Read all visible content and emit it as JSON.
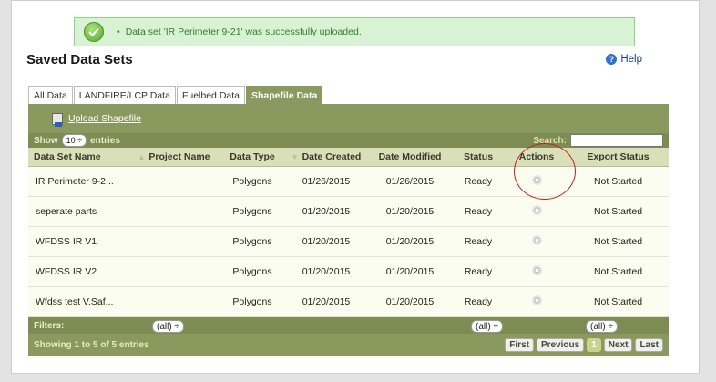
{
  "alert": {
    "message": "Data set 'IR Perimeter 9-21' was successfully uploaded.",
    "bullet": "•"
  },
  "page_title": "Saved Data Sets",
  "help_label": "Help",
  "tabs": [
    {
      "label": "All Data"
    },
    {
      "label": "LANDFIRE/LCP Data"
    },
    {
      "label": "Fuelbed Data"
    },
    {
      "label": "Shapefile Data"
    }
  ],
  "upload_label": "Upload Shapefile",
  "controls": {
    "show_label": "Show",
    "entries_value": "10 ÷",
    "entries_label": "entries",
    "search_label": "Search:"
  },
  "columns": [
    "Data Set Name",
    "Project Name",
    "Data Type",
    "Date Created",
    "Date Modified",
    "Status",
    "Actions",
    "Export Status"
  ],
  "rows": [
    {
      "name": "IR Perimeter 9-2...",
      "project": "",
      "type": "Polygons",
      "created": "01/26/2015",
      "modified": "01/26/2015",
      "status": "Ready",
      "export": "Not Started"
    },
    {
      "name": "seperate parts",
      "project": "",
      "type": "Polygons",
      "created": "01/20/2015",
      "modified": "01/20/2015",
      "status": "Ready",
      "export": "Not Started"
    },
    {
      "name": "WFDSS IR V1",
      "project": "",
      "type": "Polygons",
      "created": "01/20/2015",
      "modified": "01/20/2015",
      "status": "Ready",
      "export": "Not Started"
    },
    {
      "name": "WFDSS IR V2",
      "project": "",
      "type": "Polygons",
      "created": "01/20/2015",
      "modified": "01/20/2015",
      "status": "Ready",
      "export": "Not Started"
    },
    {
      "name": "Wfdss test V.Saf...",
      "project": "",
      "type": "Polygons",
      "created": "01/20/2015",
      "modified": "01/20/2015",
      "status": "Ready",
      "export": "Not Started"
    }
  ],
  "filters": {
    "label": "Filters:",
    "project": "(all) ÷",
    "status": "(all)   ÷",
    "export": "(all)              ÷"
  },
  "footer": {
    "info": "Showing 1 to 5 of 5 entries",
    "first": "First",
    "previous": "Previous",
    "page": "1",
    "next": "Next",
    "last": "Last"
  },
  "colors": {
    "panel": "#8a9a5e",
    "header": "#d9dfb8",
    "row": "#fbfdf0",
    "alert_bg": "#d7f3d3",
    "annotation": "#c02020"
  }
}
